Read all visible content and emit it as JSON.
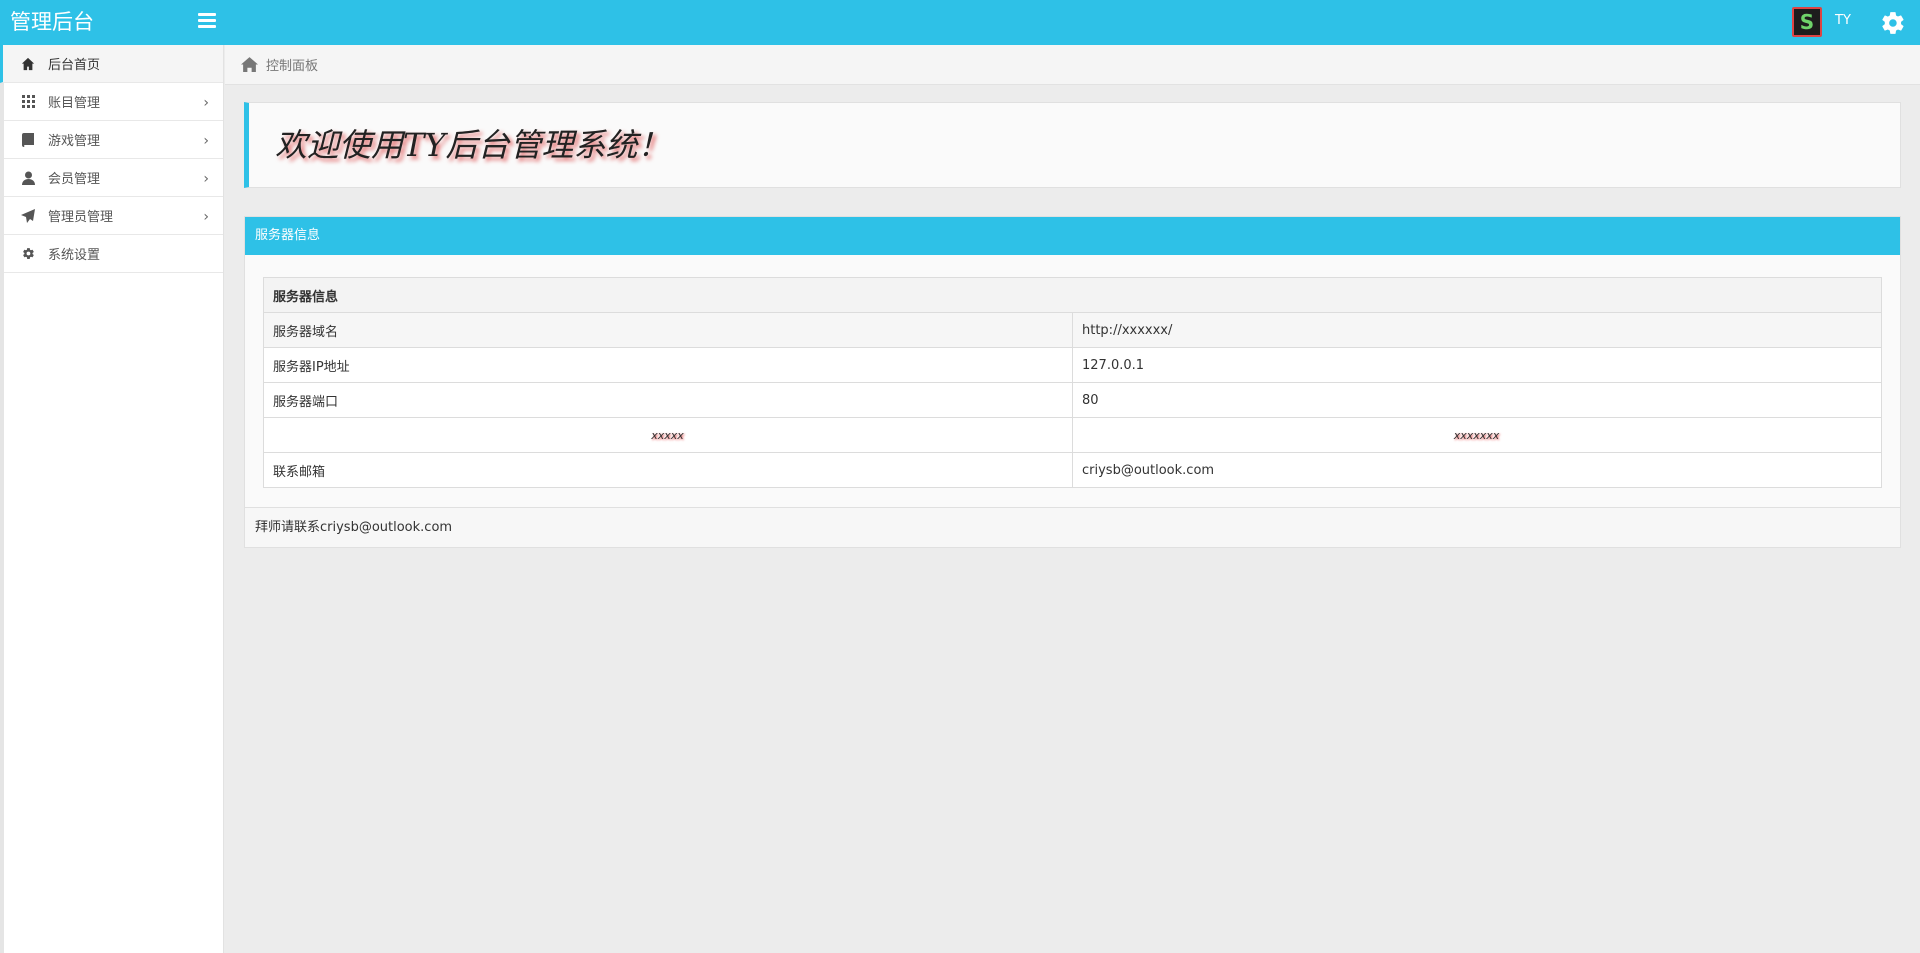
{
  "app": {
    "brand": "管理后台",
    "user_avatar_letter": "S",
    "user_name": "TY",
    "accent_color": "#2ec1e7"
  },
  "sidebar": {
    "items": [
      {
        "label": "后台首页",
        "icon": "home-icon",
        "active": true,
        "has_submenu": false
      },
      {
        "label": "账目管理",
        "icon": "grid-icon",
        "active": false,
        "has_submenu": true
      },
      {
        "label": "游戏管理",
        "icon": "book-icon",
        "active": false,
        "has_submenu": true
      },
      {
        "label": "会员管理",
        "icon": "user-icon",
        "active": false,
        "has_submenu": true
      },
      {
        "label": "管理员管理",
        "icon": "send-icon",
        "active": false,
        "has_submenu": true
      },
      {
        "label": "系统设置",
        "icon": "gear-icon",
        "active": false,
        "has_submenu": false
      }
    ],
    "chevron": "›"
  },
  "breadcrumb": {
    "label": "控制面板"
  },
  "welcome": {
    "text": "欢迎使用TY后台管理系统！"
  },
  "panel": {
    "title": "服务器信息",
    "table_header": "服务器信息",
    "rows": [
      {
        "label": "服务器域名",
        "value": "http://xxxxxx/"
      },
      {
        "label": "服务器IP地址",
        "value": "127.0.0.1"
      },
      {
        "label": "服务器端口",
        "value": "80"
      },
      {
        "label": "xxxxx",
        "value": "xxxxxxx"
      },
      {
        "label": "联系邮箱",
        "value": "criysb@outlook.com"
      }
    ],
    "footer": "拜师请联系criysb@outlook.com"
  }
}
